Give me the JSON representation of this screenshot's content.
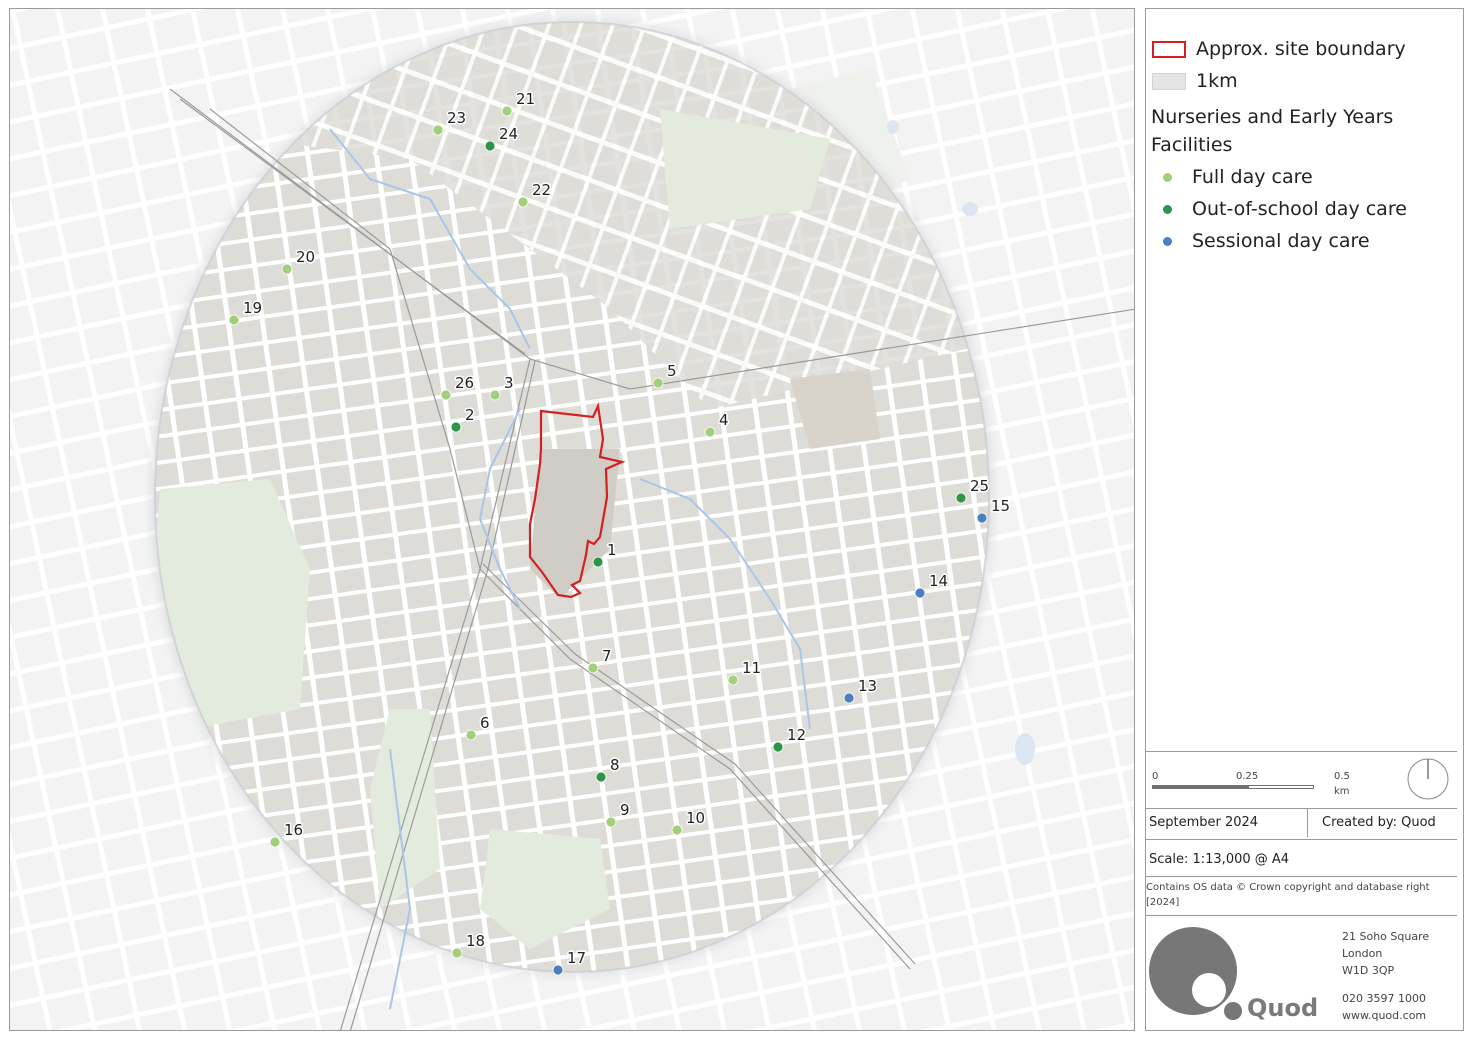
{
  "legend": {
    "boundary_label": "Approx. site boundary",
    "buffer_label": "1km",
    "heading": "Nurseries and Early Years Facilities",
    "categories": [
      {
        "name": "Full day care",
        "color": "#a3cf7c"
      },
      {
        "name": "Out-of-school day care",
        "color": "#2e9446"
      },
      {
        "name": "Sessional day care",
        "color": "#4b7fc0"
      }
    ]
  },
  "scalebar": {
    "tick0": "0",
    "tick1": "0.25",
    "tick2": "0.5 km"
  },
  "info": {
    "date": "September 2024",
    "created_by": "Created by: Quod",
    "scale": "Scale: 1:13,000 @ A4",
    "copyright_line1": "Contains OS data © Crown copyright and database right",
    "copyright_line2": "[2024]"
  },
  "company": {
    "name": "Quod",
    "address_line1": "21 Soho Square",
    "address_line2": "London",
    "address_line3": "W1D 3QP",
    "phone": "020 3597 1000",
    "website": "www.quod.com"
  },
  "facilities": [
    {
      "id": "1",
      "type": "Out-of-school day care"
    },
    {
      "id": "2",
      "type": "Out-of-school day care"
    },
    {
      "id": "3",
      "type": "Full day care"
    },
    {
      "id": "4",
      "type": "Full day care"
    },
    {
      "id": "5",
      "type": "Full day care"
    },
    {
      "id": "6",
      "type": "Full day care"
    },
    {
      "id": "7",
      "type": "Full day care"
    },
    {
      "id": "8",
      "type": "Out-of-school day care"
    },
    {
      "id": "9",
      "type": "Full day care"
    },
    {
      "id": "10",
      "type": "Full day care"
    },
    {
      "id": "11",
      "type": "Full day care"
    },
    {
      "id": "12",
      "type": "Out-of-school day care"
    },
    {
      "id": "13",
      "type": "Sessional day care"
    },
    {
      "id": "14",
      "type": "Sessional day care"
    },
    {
      "id": "15",
      "type": "Sessional day care"
    },
    {
      "id": "16",
      "type": "Full day care"
    },
    {
      "id": "17",
      "type": "Sessional day care"
    },
    {
      "id": "18",
      "type": "Full day care"
    },
    {
      "id": "19",
      "type": "Full day care"
    },
    {
      "id": "20",
      "type": "Full day care"
    },
    {
      "id": "21",
      "type": "Full day care"
    },
    {
      "id": "22",
      "type": "Full day care"
    },
    {
      "id": "23",
      "type": "Full day care"
    },
    {
      "id": "24",
      "type": "Out-of-school day care"
    },
    {
      "id": "25",
      "type": "Out-of-school day care"
    },
    {
      "id": "26",
      "type": "Full day care"
    }
  ],
  "colors": {
    "site_boundary": "#d42020",
    "water": "#a9c6e8",
    "green_space": "#e2ebdc",
    "buffer_fill": "#dcdad5",
    "road": "#ffffff"
  }
}
